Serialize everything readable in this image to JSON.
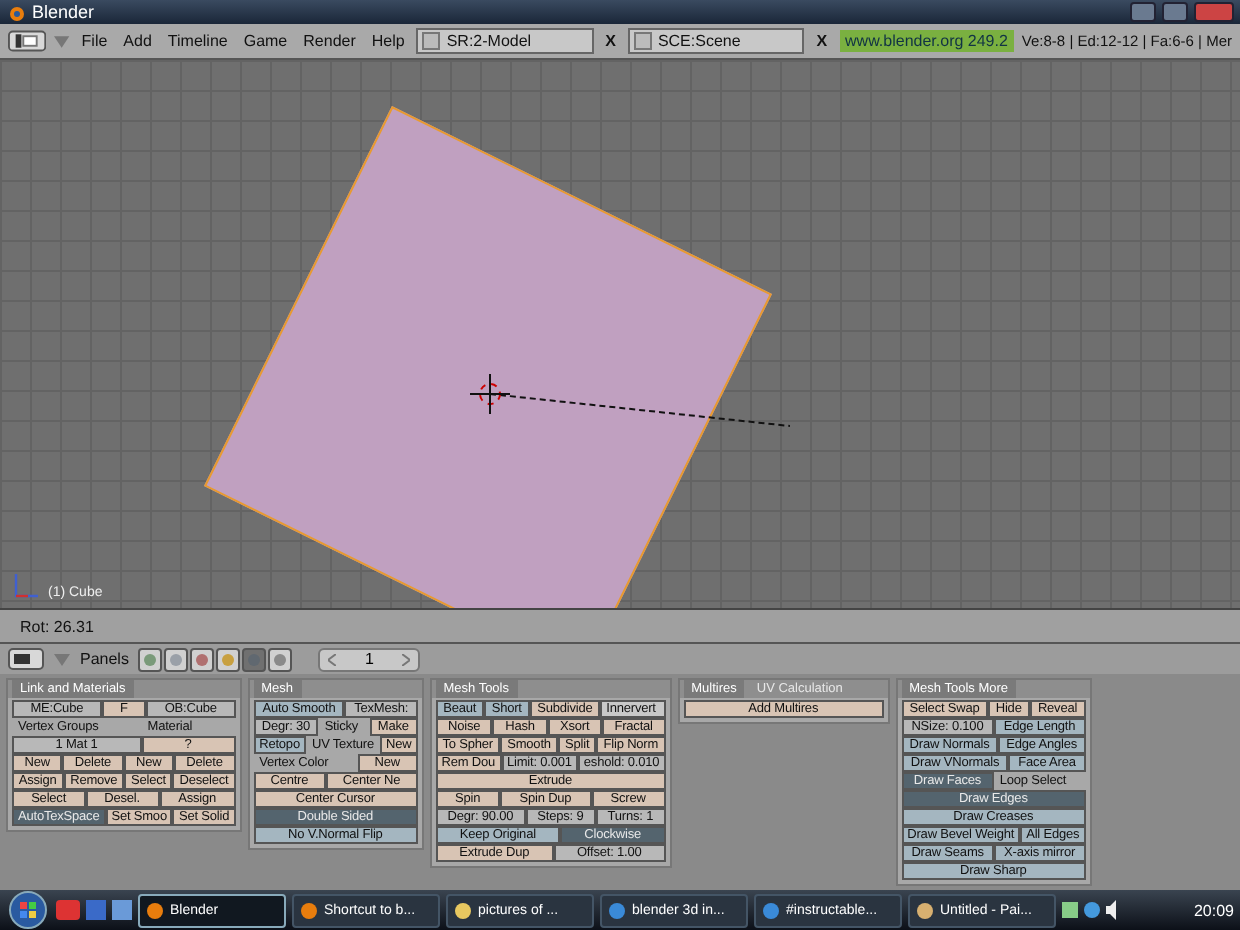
{
  "window": {
    "title": "Blender"
  },
  "menu": [
    "File",
    "Add",
    "Timeline",
    "Game",
    "Render",
    "Help"
  ],
  "screen_field": {
    "value": "SR:2-Model",
    "close": "X"
  },
  "scene_field": {
    "value": "SCE:Scene",
    "close": "X"
  },
  "version": "www.blender.org 249.2",
  "stats": "Ve:8-8 | Ed:12-12 | Fa:6-6 | Mer",
  "viewport": {
    "object_label": "(1) Cube"
  },
  "header": {
    "readout": "Rot: 26.31"
  },
  "buttons_header": {
    "panels_label": "Panels",
    "counter": "1",
    "context_buttons": [
      {
        "kind": "logic",
        "selected": false
      },
      {
        "kind": "script",
        "selected": false
      },
      {
        "kind": "shading",
        "selected": false
      },
      {
        "kind": "object",
        "selected": false
      },
      {
        "kind": "editing",
        "selected": true
      },
      {
        "kind": "scene",
        "selected": false
      }
    ]
  },
  "panels": [
    {
      "tabs": [
        {
          "label": "Link and Materials",
          "selected": true
        }
      ],
      "rows": [
        [
          {
            "label": "ME:Cube",
            "kind": "field",
            "on": false
          },
          {
            "label": "F",
            "kind": "button",
            "on": false
          },
          {
            "label": "OB:Cube",
            "kind": "field",
            "on": false
          }
        ],
        [
          {
            "label": "Vertex Groups",
            "kind": "text",
            "on": false
          },
          {
            "label": "Material",
            "kind": "text",
            "on": false
          }
        ],
        [
          {
            "label": "1 Mat 1",
            "kind": "field",
            "on": false
          },
          {
            "label": "?",
            "kind": "button",
            "on": false
          }
        ],
        [
          {
            "label": "New",
            "kind": "button",
            "on": false
          },
          {
            "label": "Delete",
            "kind": "button",
            "on": false
          },
          {
            "label": "New",
            "kind": "button",
            "on": false
          },
          {
            "label": "Delete",
            "kind": "button",
            "on": false
          }
        ],
        [
          {
            "label": "Assign",
            "kind": "button",
            "on": false
          },
          {
            "label": "Remove",
            "kind": "button",
            "on": false
          },
          {
            "label": "Select",
            "kind": "button",
            "on": false
          },
          {
            "label": "Deselect",
            "kind": "button",
            "on": false
          }
        ],
        [
          {
            "label": "Select",
            "kind": "button",
            "on": false
          },
          {
            "label": "Desel.",
            "kind": "button",
            "on": false
          },
          {
            "label": "Assign",
            "kind": "button",
            "on": false
          }
        ],
        [
          {
            "label": "AutoTexSpace",
            "kind": "toggle",
            "on": true
          },
          {
            "label": "Set Smoo",
            "kind": "button",
            "on": false
          },
          {
            "label": "Set Solid",
            "kind": "button",
            "on": false
          }
        ]
      ]
    },
    {
      "tabs": [
        {
          "label": "Mesh",
          "selected": true
        }
      ],
      "rows": [
        [
          {
            "label": "Auto Smooth",
            "kind": "toggle",
            "on": false
          },
          {
            "label": "TexMesh:",
            "kind": "field",
            "on": false
          }
        ],
        [
          {
            "label": "Degr: 30",
            "kind": "field",
            "on": false
          },
          {
            "label": "Sticky",
            "kind": "text",
            "on": false
          },
          {
            "label": "Make",
            "kind": "button",
            "on": false
          }
        ],
        [
          {
            "label": "Retopo",
            "kind": "toggle",
            "on": false
          },
          {
            "label": "UV Texture",
            "kind": "text",
            "on": false
          },
          {
            "label": "New",
            "kind": "button",
            "on": false
          }
        ],
        [
          {
            "label": "Vertex Color",
            "kind": "text",
            "on": false
          },
          {
            "label": "New",
            "kind": "button",
            "on": false
          }
        ],
        [
          {
            "label": "Centre",
            "kind": "button",
            "on": false
          },
          {
            "label": "Center Ne",
            "kind": "button",
            "on": false
          }
        ],
        [
          {
            "label": "Center Cursor",
            "kind": "button",
            "on": false
          }
        ],
        [
          {
            "label": "Double Sided",
            "kind": "toggle",
            "on": true
          }
        ],
        [
          {
            "label": "No V.Normal Flip",
            "kind": "toggle",
            "on": false
          }
        ]
      ]
    },
    {
      "tabs": [
        {
          "label": "Mesh Tools",
          "selected": true
        }
      ],
      "rows": [
        [
          {
            "label": "Beaut",
            "kind": "toggle",
            "on": false
          },
          {
            "label": "Short",
            "kind": "toggle",
            "on": false
          },
          {
            "label": "Subdivide",
            "kind": "button",
            "on": false
          },
          {
            "label": "Innervert",
            "kind": "menu",
            "on": false
          }
        ],
        [
          {
            "label": "Noise",
            "kind": "button",
            "on": false
          },
          {
            "label": "Hash",
            "kind": "button",
            "on": false
          },
          {
            "label": "Xsort",
            "kind": "button",
            "on": false
          },
          {
            "label": "Fractal",
            "kind": "button",
            "on": false
          }
        ],
        [
          {
            "label": "To Spher",
            "kind": "button",
            "on": false
          },
          {
            "label": "Smooth",
            "kind": "button",
            "on": false
          },
          {
            "label": "Split",
            "kind": "button",
            "on": false
          },
          {
            "label": "Flip Norm",
            "kind": "button",
            "on": false
          }
        ],
        [
          {
            "label": "Rem Dou",
            "kind": "button",
            "on": false
          },
          {
            "label": "Limit: 0.001",
            "kind": "field",
            "on": false
          },
          {
            "label": "eshold: 0.010",
            "kind": "field",
            "on": false
          }
        ],
        [
          {
            "label": "Extrude",
            "kind": "button",
            "on": false
          }
        ],
        [
          {
            "label": "Spin",
            "kind": "button",
            "on": false
          },
          {
            "label": "Spin Dup",
            "kind": "button",
            "on": false
          },
          {
            "label": "Screw",
            "kind": "button",
            "on": false
          }
        ],
        [
          {
            "label": "Degr: 90.00",
            "kind": "field",
            "on": false
          },
          {
            "label": "Steps: 9",
            "kind": "field",
            "on": false
          },
          {
            "label": "Turns: 1",
            "kind": "field",
            "on": false
          }
        ],
        [
          {
            "label": "Keep Original",
            "kind": "toggle",
            "on": false
          },
          {
            "label": "Clockwise",
            "kind": "toggle",
            "on": true
          }
        ],
        [
          {
            "label": "Extrude Dup",
            "kind": "button",
            "on": false
          },
          {
            "label": "Offset: 1.00",
            "kind": "field",
            "on": false
          }
        ]
      ]
    },
    {
      "tabs": [
        {
          "label": "Multires",
          "selected": true
        },
        {
          "label": "UV Calculation",
          "selected": false
        }
      ],
      "rows": [
        [
          {
            "label": "Add Multires",
            "kind": "button",
            "on": false
          }
        ]
      ]
    },
    {
      "tabs": [
        {
          "label": "Mesh Tools More",
          "selected": true
        }
      ],
      "rows": [
        [
          {
            "label": "Select Swap",
            "kind": "button",
            "on": false
          },
          {
            "label": "Hide",
            "kind": "button",
            "on": false
          },
          {
            "label": "Reveal",
            "kind": "button",
            "on": false
          }
        ],
        [
          {
            "label": "NSize: 0.100",
            "kind": "field",
            "on": false
          },
          {
            "label": "Edge Length",
            "kind": "toggle",
            "on": false
          }
        ],
        [
          {
            "label": "Draw Normals",
            "kind": "toggle",
            "on": false
          },
          {
            "label": "Edge Angles",
            "kind": "toggle",
            "on": false
          }
        ],
        [
          {
            "label": "Draw VNormals",
            "kind": "toggle",
            "on": false
          },
          {
            "label": "Face Area",
            "kind": "toggle",
            "on": false
          }
        ],
        [
          {
            "label": "Draw Faces",
            "kind": "toggle",
            "on": true
          },
          {
            "label": "Loop Select",
            "kind": "text",
            "on": false
          }
        ],
        [
          {
            "label": "Draw Edges",
            "kind": "toggle",
            "on": true
          }
        ],
        [
          {
            "label": "Draw Creases",
            "kind": "toggle",
            "on": false
          }
        ],
        [
          {
            "label": "Draw Bevel Weight",
            "kind": "toggle",
            "on": false
          },
          {
            "label": "All Edges",
            "kind": "toggle",
            "on": false
          }
        ],
        [
          {
            "label": "Draw Seams",
            "kind": "toggle",
            "on": false
          },
          {
            "label": "X-axis mirror",
            "kind": "toggle",
            "on": false
          }
        ],
        [
          {
            "label": "Draw Sharp",
            "kind": "toggle",
            "on": false
          }
        ]
      ]
    }
  ],
  "taskbar": {
    "items": [
      {
        "label": "Blender",
        "kind": "blender",
        "selected": true
      },
      {
        "label": "Shortcut to b...",
        "kind": "blender",
        "selected": false
      },
      {
        "label": "pictures of ...",
        "kind": "folder",
        "selected": false
      },
      {
        "label": "blender 3d in...",
        "kind": "browser",
        "selected": false
      },
      {
        "label": "#instructable...",
        "kind": "browser",
        "selected": false
      },
      {
        "label": "Untitled - Pai...",
        "kind": "paint",
        "selected": false
      }
    ],
    "clock": "20:09"
  }
}
